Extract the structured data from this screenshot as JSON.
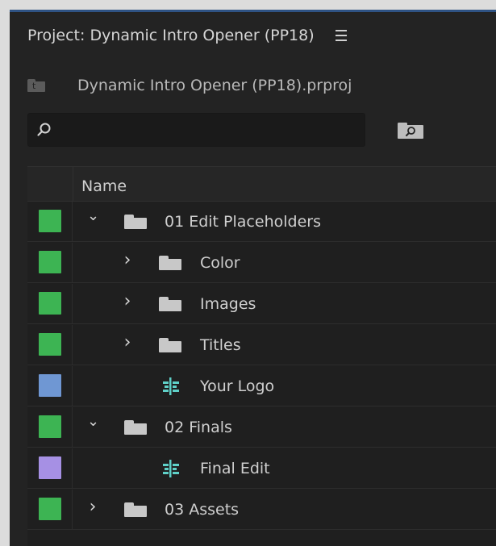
{
  "panel": {
    "title": "Project: Dynamic Intro Opener (PP18)",
    "project_file": "Dynamic Intro Opener (PP18).prproj"
  },
  "search": {
    "value": "",
    "placeholder": ""
  },
  "columns": {
    "name_header": "Name"
  },
  "colors": {
    "green_label": "#3db453",
    "blue_label": "#6f97d3",
    "lavender_label": "#a690e4",
    "sequence_icon_cyan": "#5fd0c8"
  },
  "items": [
    {
      "name": "01 Edit Placeholders",
      "type": "bin",
      "expanded": true,
      "level": 0,
      "label_color": "green"
    },
    {
      "name": "Color",
      "type": "bin",
      "expanded": false,
      "level": 1,
      "label_color": "green"
    },
    {
      "name": "Images",
      "type": "bin",
      "expanded": false,
      "level": 1,
      "label_color": "green"
    },
    {
      "name": "Titles",
      "type": "bin",
      "expanded": false,
      "level": 1,
      "label_color": "green"
    },
    {
      "name": "Your Logo",
      "type": "sequence",
      "level": 1,
      "label_color": "blue"
    },
    {
      "name": "02 Finals",
      "type": "bin",
      "expanded": true,
      "level": 0,
      "label_color": "green"
    },
    {
      "name": "Final Edit",
      "type": "sequence",
      "level": 1,
      "label_color": "lavender"
    },
    {
      "name": "03 Assets",
      "type": "bin",
      "expanded": false,
      "level": 0,
      "label_color": "green"
    }
  ]
}
